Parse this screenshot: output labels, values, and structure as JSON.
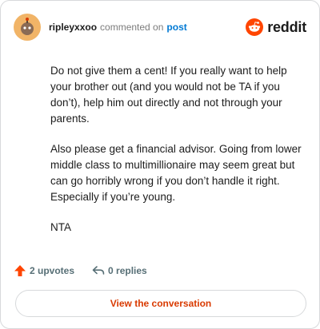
{
  "header": {
    "username": "ripleyxxoo",
    "action": "commented on",
    "post_link": "post",
    "brand": "reddit"
  },
  "comment": {
    "paragraphs": [
      "Do not give them a cent! If you really want to help your brother out (and you would not be TA if you don’t), help him out directly and not through your parents.",
      "Also please get a financial advisor. Going from lower middle class to multimillionaire may seem great but can go horribly wrong if you don’t handle it right. Especially if you’re young.",
      "NTA"
    ]
  },
  "footer": {
    "upvotes": "2 upvotes",
    "replies": "0 replies"
  },
  "cta": {
    "label": "View the conversation"
  },
  "colors": {
    "upvote": "#ff4500",
    "link": "#0079d3",
    "cta": "#d93a00"
  }
}
